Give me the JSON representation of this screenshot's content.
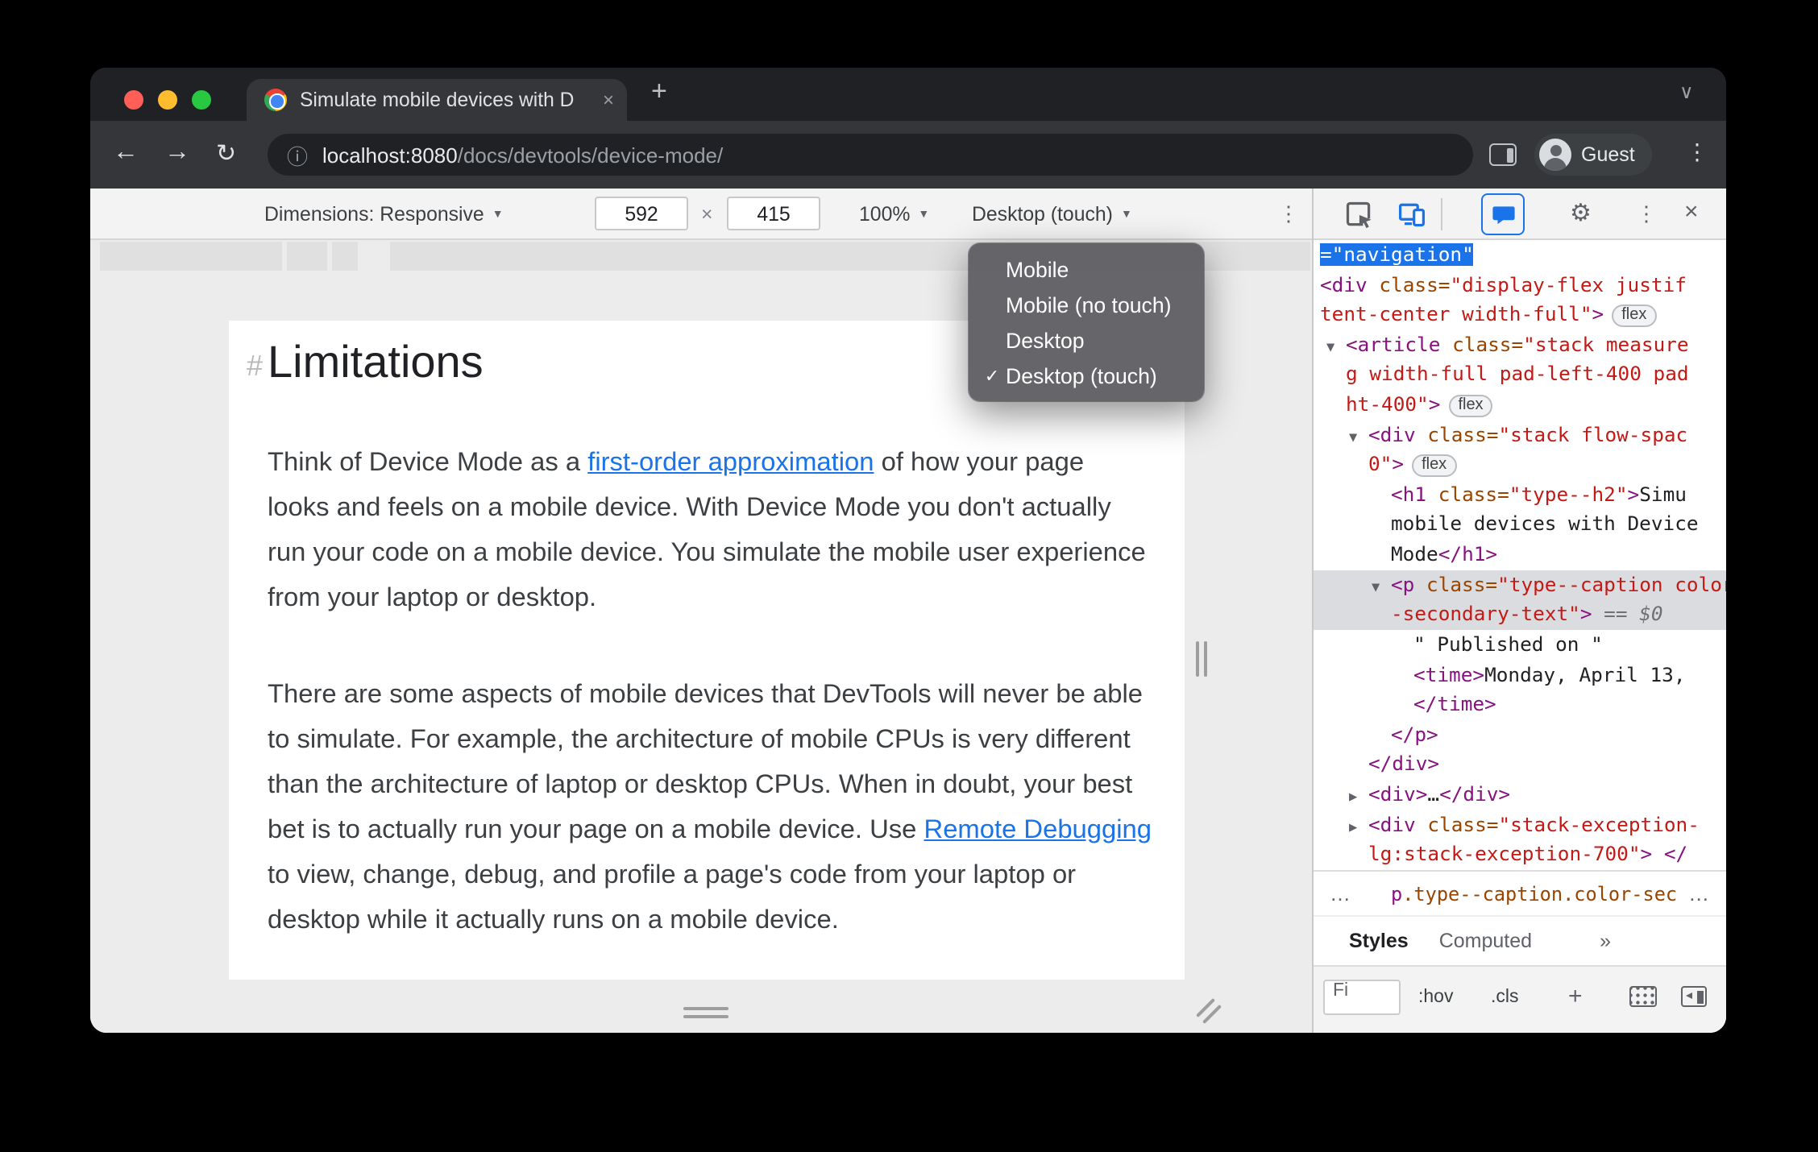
{
  "browser": {
    "tab_title": "Simulate mobile devices with D",
    "tab_close": "×",
    "new_tab": "+",
    "tab_overflow_chevron": "∨",
    "back": "←",
    "forward": "→",
    "reload": "↻",
    "url_info": "ⓘ",
    "url_host": "localhost:8080",
    "url_path": "/docs/devtools/device-mode/",
    "profile_label": "Guest",
    "menu_dots": "⋮"
  },
  "device_toolbar": {
    "dimensions_label": "Dimensions: Responsive",
    "width_value": "592",
    "separator": "×",
    "height_value": "415",
    "zoom_value": "100%",
    "device_type_value": "Desktop (touch)",
    "caret": "▼",
    "more_dots": "⋮"
  },
  "device_type_menu": {
    "checkmark": "✓",
    "items": [
      {
        "label": "Mobile",
        "checked": false
      },
      {
        "label": "Mobile (no touch)",
        "checked": false
      },
      {
        "label": "Desktop",
        "checked": false
      },
      {
        "label": "Desktop (touch)",
        "checked": true
      }
    ]
  },
  "page": {
    "heading_anchor": "#",
    "heading": "Limitations",
    "paragraphs": [
      {
        "lines": [
          [
            {
              "t": "Think of Device Mode as a "
            },
            {
              "t": "first-order approximation",
              "link": true
            },
            {
              "t": " of how your page"
            }
          ],
          [
            {
              "t": "looks and feels on a mobile device. With Device Mode you don't actually"
            }
          ],
          [
            {
              "t": "run your code on a mobile device. You simulate the mobile user experience"
            }
          ],
          [
            {
              "t": "from your laptop or desktop."
            }
          ]
        ]
      },
      {
        "lines": [
          [
            {
              "t": "There are some aspects of mobile devices that DevTools will never be able"
            }
          ],
          [
            {
              "t": "to simulate. For example, the architecture of mobile CPUs is very different"
            }
          ],
          [
            {
              "t": "than the architecture of laptop or desktop CPUs. When in doubt, your best"
            }
          ],
          [
            {
              "t": "bet is to actually run your page on a mobile device. Use "
            },
            {
              "t": "Remote Debugging",
              "link": true
            }
          ],
          [
            {
              "t": "to view, change, debug, and profile a page's code from your laptop or"
            }
          ],
          [
            {
              "t": "desktop while it actually runs on a mobile device."
            }
          ]
        ]
      }
    ]
  },
  "devtools": {
    "toolbar": {
      "gear": "⚙",
      "dots": "⋮",
      "close": "×"
    },
    "elements_lines": [
      {
        "pad": 4,
        "segs": [
          {
            "c": "sel",
            "t": "=\"navigation\""
          }
        ]
      },
      {
        "pad": 4,
        "segs": [
          {
            "c": "tag",
            "t": "<div "
          },
          {
            "c": "attr",
            "t": "class="
          },
          {
            "c": "val",
            "t": "\"display-flex justif"
          }
        ]
      },
      {
        "pad": 4,
        "segs": [
          {
            "c": "val",
            "t": "tent-center width-full\""
          },
          {
            "c": "tag",
            "t": ">"
          },
          {
            "c": "badge",
            "t": "flex"
          }
        ]
      },
      {
        "pad": 8,
        "marker": "▼",
        "segs": [
          {
            "c": "tag",
            "t": "<article "
          },
          {
            "c": "attr",
            "t": "class="
          },
          {
            "c": "val",
            "t": "\"stack measure"
          }
        ]
      },
      {
        "pad": 20,
        "segs": [
          {
            "c": "val",
            "t": "g width-full pad-left-400 pad"
          }
        ]
      },
      {
        "pad": 20,
        "segs": [
          {
            "c": "val",
            "t": "ht-400\""
          },
          {
            "c": "tag",
            "t": ">"
          },
          {
            "c": "badge",
            "t": "flex"
          }
        ]
      },
      {
        "pad": 22,
        "marker": "▼",
        "segs": [
          {
            "c": "tag",
            "t": "<div "
          },
          {
            "c": "attr",
            "t": "class="
          },
          {
            "c": "val",
            "t": "\"stack flow-spac"
          }
        ]
      },
      {
        "pad": 34,
        "segs": [
          {
            "c": "val",
            "t": "0\""
          },
          {
            "c": "tag",
            "t": ">"
          },
          {
            "c": "badge",
            "t": "flex"
          }
        ]
      },
      {
        "pad": 48,
        "segs": [
          {
            "c": "tag",
            "t": "<h1 "
          },
          {
            "c": "attr",
            "t": "class="
          },
          {
            "c": "val",
            "t": "\"type--h2\""
          },
          {
            "c": "tag",
            "t": ">"
          },
          {
            "c": "txt",
            "t": "Simu"
          }
        ]
      },
      {
        "pad": 48,
        "segs": [
          {
            "c": "txt",
            "t": "mobile devices with Device"
          }
        ]
      },
      {
        "pad": 48,
        "segs": [
          {
            "c": "txt",
            "t": "Mode"
          },
          {
            "c": "tag",
            "t": "</h1>"
          }
        ]
      },
      {
        "pad": 36,
        "marker": "▼",
        "hl": true,
        "segs": [
          {
            "c": "tag",
            "t": "<p "
          },
          {
            "c": "attr",
            "t": "class="
          },
          {
            "c": "val",
            "t": "\"type--caption color"
          }
        ]
      },
      {
        "pad": 48,
        "hl": true,
        "segs": [
          {
            "c": "val",
            "t": "-secondary-text\""
          },
          {
            "c": "tag",
            "t": ">"
          },
          {
            "c": "eq",
            "t": " == $0"
          }
        ]
      },
      {
        "pad": 62,
        "segs": [
          {
            "c": "txt",
            "t": "\" Published on \""
          }
        ]
      },
      {
        "pad": 62,
        "segs": [
          {
            "c": "tag",
            "t": "<time>"
          },
          {
            "c": "txt",
            "t": "Monday, April 13,"
          }
        ]
      },
      {
        "pad": 62,
        "segs": [
          {
            "c": "tag",
            "t": "</time>"
          }
        ]
      },
      {
        "pad": 48,
        "segs": [
          {
            "c": "tag",
            "t": "</p>"
          }
        ]
      },
      {
        "pad": 34,
        "segs": [
          {
            "c": "tag",
            "t": "</div>"
          }
        ]
      },
      {
        "pad": 22,
        "marker": "▶",
        "segs": [
          {
            "c": "tag",
            "t": "<div>"
          },
          {
            "c": "txt",
            "t": "…"
          },
          {
            "c": "tag",
            "t": "</div>"
          }
        ]
      },
      {
        "pad": 22,
        "marker": "▶",
        "segs": [
          {
            "c": "tag",
            "t": "<div "
          },
          {
            "c": "attr",
            "t": "class="
          },
          {
            "c": "val",
            "t": "\"stack-exception-"
          }
        ]
      },
      {
        "pad": 34,
        "segs": [
          {
            "c": "val",
            "t": "lg:stack-exception-700\""
          },
          {
            "c": "tag",
            "t": "> </"
          }
        ]
      }
    ],
    "breadcrumb": {
      "left_ellipsis": "…",
      "tag": "p",
      "classes": ".type--caption.color-sec",
      "right_ellipsis": "…"
    },
    "tabs": [
      {
        "label": "Styles",
        "active": true
      },
      {
        "label": "Computed",
        "active": false
      },
      {
        "label": "»",
        "active": false
      }
    ],
    "filter": {
      "value": "Fi",
      "hov": ":hov",
      "cls": ".cls",
      "plus": "+"
    }
  },
  "colors": {
    "accent_blue": "#1a73e8",
    "devtools_tag": "#881280",
    "devtools_attr_name": "#994500",
    "devtools_attr_value": "#c41a16",
    "selected_node_gray": "#dadce0",
    "selection_blue": "#1a73e8",
    "traffic_red": "#ff5f57",
    "traffic_yellow": "#febc2e",
    "traffic_green": "#28c840"
  }
}
